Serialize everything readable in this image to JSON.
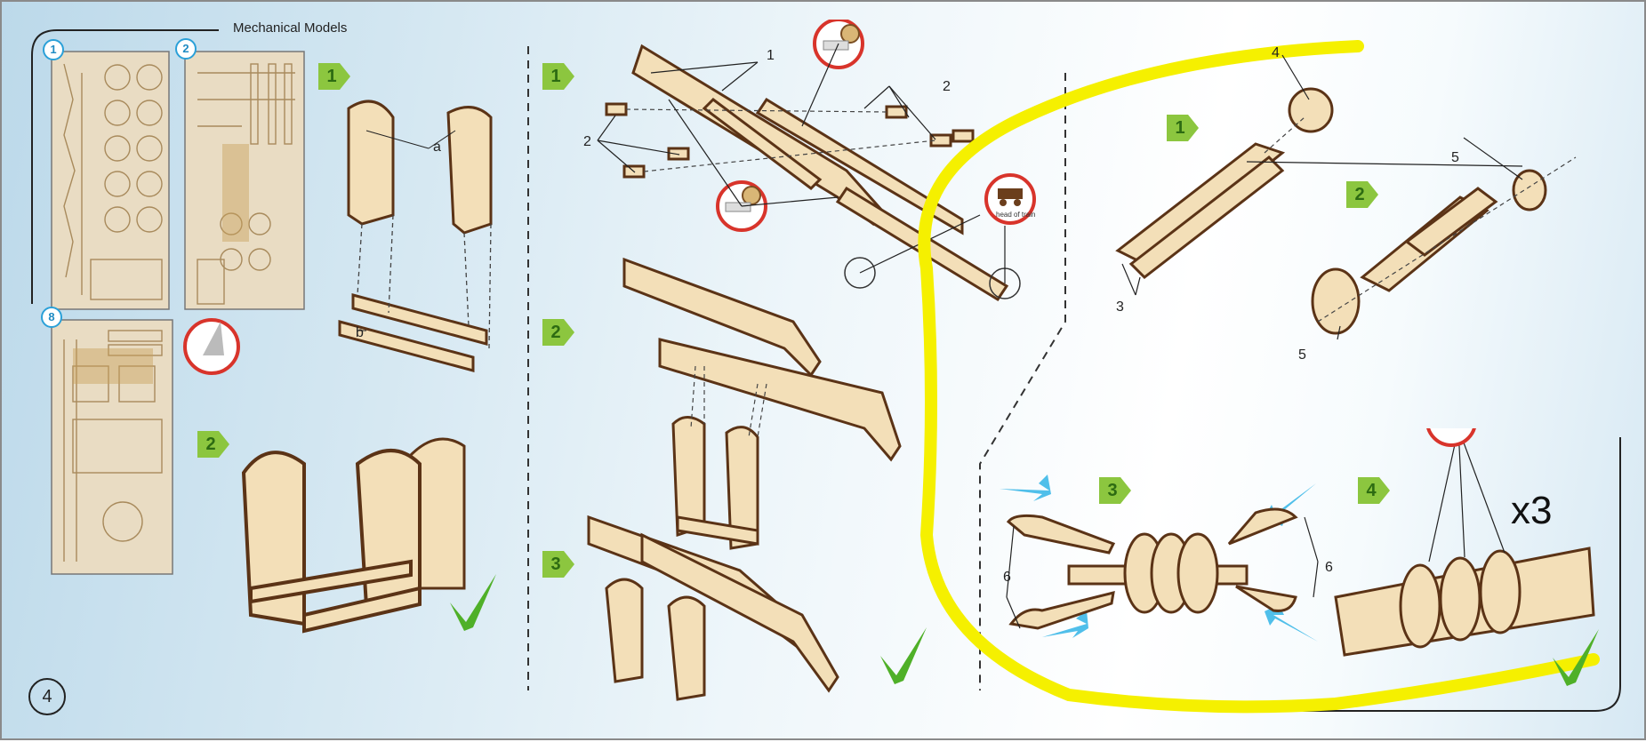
{
  "header": {
    "brand": "Mechanical Models"
  },
  "page": {
    "number": "4"
  },
  "sheets": [
    {
      "label": "1"
    },
    {
      "label": "2"
    },
    {
      "label": "8"
    }
  ],
  "sections": {
    "a": {
      "steps": [
        "1",
        "2"
      ],
      "part_labels": [
        "a",
        "b"
      ]
    },
    "b": {
      "steps": [
        "1",
        "2",
        "3"
      ],
      "part_labels": [
        "1",
        "2",
        "2"
      ]
    },
    "c": {
      "steps": [
        "1",
        "2",
        "3",
        "4"
      ],
      "part_labels": [
        "4",
        "3",
        "5",
        "5",
        "6",
        "6"
      ],
      "multiplier": "x3"
    }
  },
  "badges": {
    "head_of_train": "head of train"
  },
  "colors": {
    "wood": "#f3dfb8",
    "wood_edge": "#5b3316",
    "step_badge": "#8cc63f",
    "check": "#4fb028",
    "highlight": "#f5f000",
    "arrow": "#3db8e8",
    "badge_ring": "#d8342b"
  }
}
